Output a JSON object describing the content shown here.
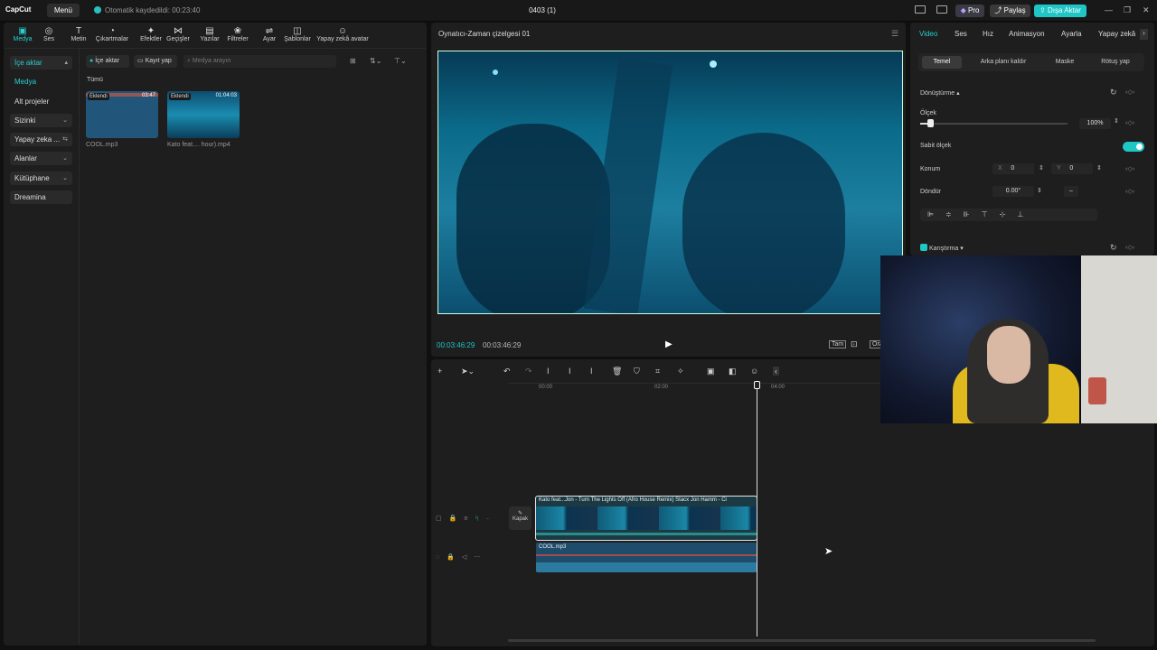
{
  "app": {
    "logo": "CapCut",
    "menu": "Menü",
    "autosave": "Otomatik kaydedildi: 00:23:40",
    "project": "0403 (1)",
    "pro": "Pro",
    "share": "Paylaş",
    "export": "Dışa Aktar"
  },
  "toolbar": [
    {
      "label": "Medya",
      "icon": "media-icon"
    },
    {
      "label": "Ses",
      "icon": "audio-icon"
    },
    {
      "label": "Metin",
      "icon": "text-icon"
    },
    {
      "label": "Çıkartmalar",
      "icon": "sticker-icon"
    },
    {
      "label": "Efektler",
      "icon": "effects-icon"
    },
    {
      "label": "Geçişler",
      "icon": "transitions-icon"
    },
    {
      "label": "Yazılar",
      "icon": "captions-icon"
    },
    {
      "label": "Filtreler",
      "icon": "filters-icon"
    },
    {
      "label": "Ayar",
      "icon": "adjust-icon"
    },
    {
      "label": "Şablonlar",
      "icon": "templates-icon"
    },
    {
      "label": "Yapay zekâ avatar",
      "icon": "ai-avatar-icon"
    }
  ],
  "sidenav": [
    {
      "label": "İçe aktar"
    },
    {
      "label": "Medya"
    },
    {
      "label": "Alt projeler"
    },
    {
      "label": "Sizinki"
    },
    {
      "label": "Yapay zeka ..."
    },
    {
      "label": "Alanlar"
    },
    {
      "label": "Kütüphane"
    },
    {
      "label": "Dreamina"
    }
  ],
  "media": {
    "import": "İçe aktar",
    "record": "Kayıt yap",
    "search_placeholder": "Medya arayın",
    "filter_all": "Tümü",
    "items": [
      {
        "badge": "Eklendi",
        "duration": "03:47",
        "name": "COOL.mp3"
      },
      {
        "badge": "Eklendi",
        "duration": "01:04:03",
        "name": "Kato feat.... hour).mp4"
      }
    ]
  },
  "player": {
    "title": "Oynatıcı-Zaman çizelgesi 01",
    "current": "00:03:46:29",
    "total": "00:03:46:29",
    "full": "Tam",
    "ratio": "Ora"
  },
  "right": {
    "tabs": [
      "Video",
      "Ses",
      "Hız",
      "Animasyon",
      "Ayarla",
      "Yapay zekâ"
    ],
    "subtabs": [
      "Temel",
      "Arka planı kaldır",
      "Maske",
      "Rötuş yap"
    ],
    "transform": "Dönüştürme",
    "scale": "Ölçek",
    "scale_value": "100%",
    "scale_level": 0.07,
    "uniform": "Sabit ölçek",
    "position": "Konum",
    "x_label": "X",
    "x_value": "0",
    "y_label": "Y",
    "y_value": "0",
    "rotate": "Döndür",
    "rotate_value": "0.00°",
    "rotate_minus": "–",
    "blend": "Karıştırma"
  },
  "timeline": {
    "ticks": [
      "00:00",
      "02:00",
      "04:00"
    ],
    "video_clip": "Kato feat...Jon - Turn The Lights Off (Afro House Remix) Stacx Jon Hamm - Ci",
    "cover": "Kapak",
    "audio_clip": "COOL.mp3"
  },
  "colors": {
    "accent": "#1fc6c6"
  }
}
